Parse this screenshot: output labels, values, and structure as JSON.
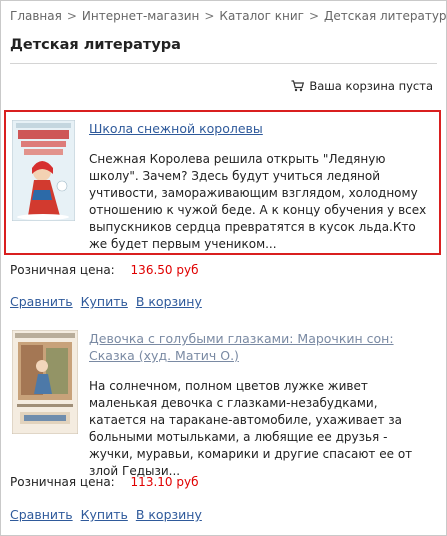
{
  "breadcrumb": {
    "items": [
      "Главная",
      "Интернет-магазин",
      "Каталог книг",
      "Детская литература"
    ],
    "separator": ">"
  },
  "page": {
    "title": "Детская литература"
  },
  "cart": {
    "status": "Ваша корзина пуста",
    "icon": "cart-icon"
  },
  "colors": {
    "link": "#2f5a9b",
    "visited_link": "#7a8aa3",
    "price": "#e00000",
    "highlight_border": "#d91f1f"
  },
  "products": [
    {
      "title": "Школа снежной королевы",
      "description": "Снежная Королева решила открыть \"Ледяную школу\". Зачем? Здесь будут учиться ледяной учтивости, замораживающим взглядом, холодному отношению к чужой беде. А к концу обучения у всех выпускников сердца превратятся в кусок льда.Кто же будет первым учеником...",
      "price_label": "Розничная цена:",
      "price": "136.50 руб",
      "actions": {
        "compare": "Сравнить",
        "buy": "Купить",
        "to_cart": "В корзину"
      },
      "highlighted": true
    },
    {
      "title": "Девочка с голубыми глазками: Марочкин сон: Сказка (худ. Матич О.)",
      "description": "На солнечном, полном цветов лужке живет маленькая девочка с глазками-незабудками, катается на таракане-автомобиле, ухаживает за больными мотыльками, а любящие ее друзья - жучки, муравьи, комарики и другие спасают ее от злой Гедызи...",
      "price_label": "Розничная цена:",
      "price": "113.10 руб",
      "actions": {
        "compare": "Сравнить",
        "buy": "Купить",
        "to_cart": "В корзину"
      },
      "highlighted": false
    }
  ]
}
